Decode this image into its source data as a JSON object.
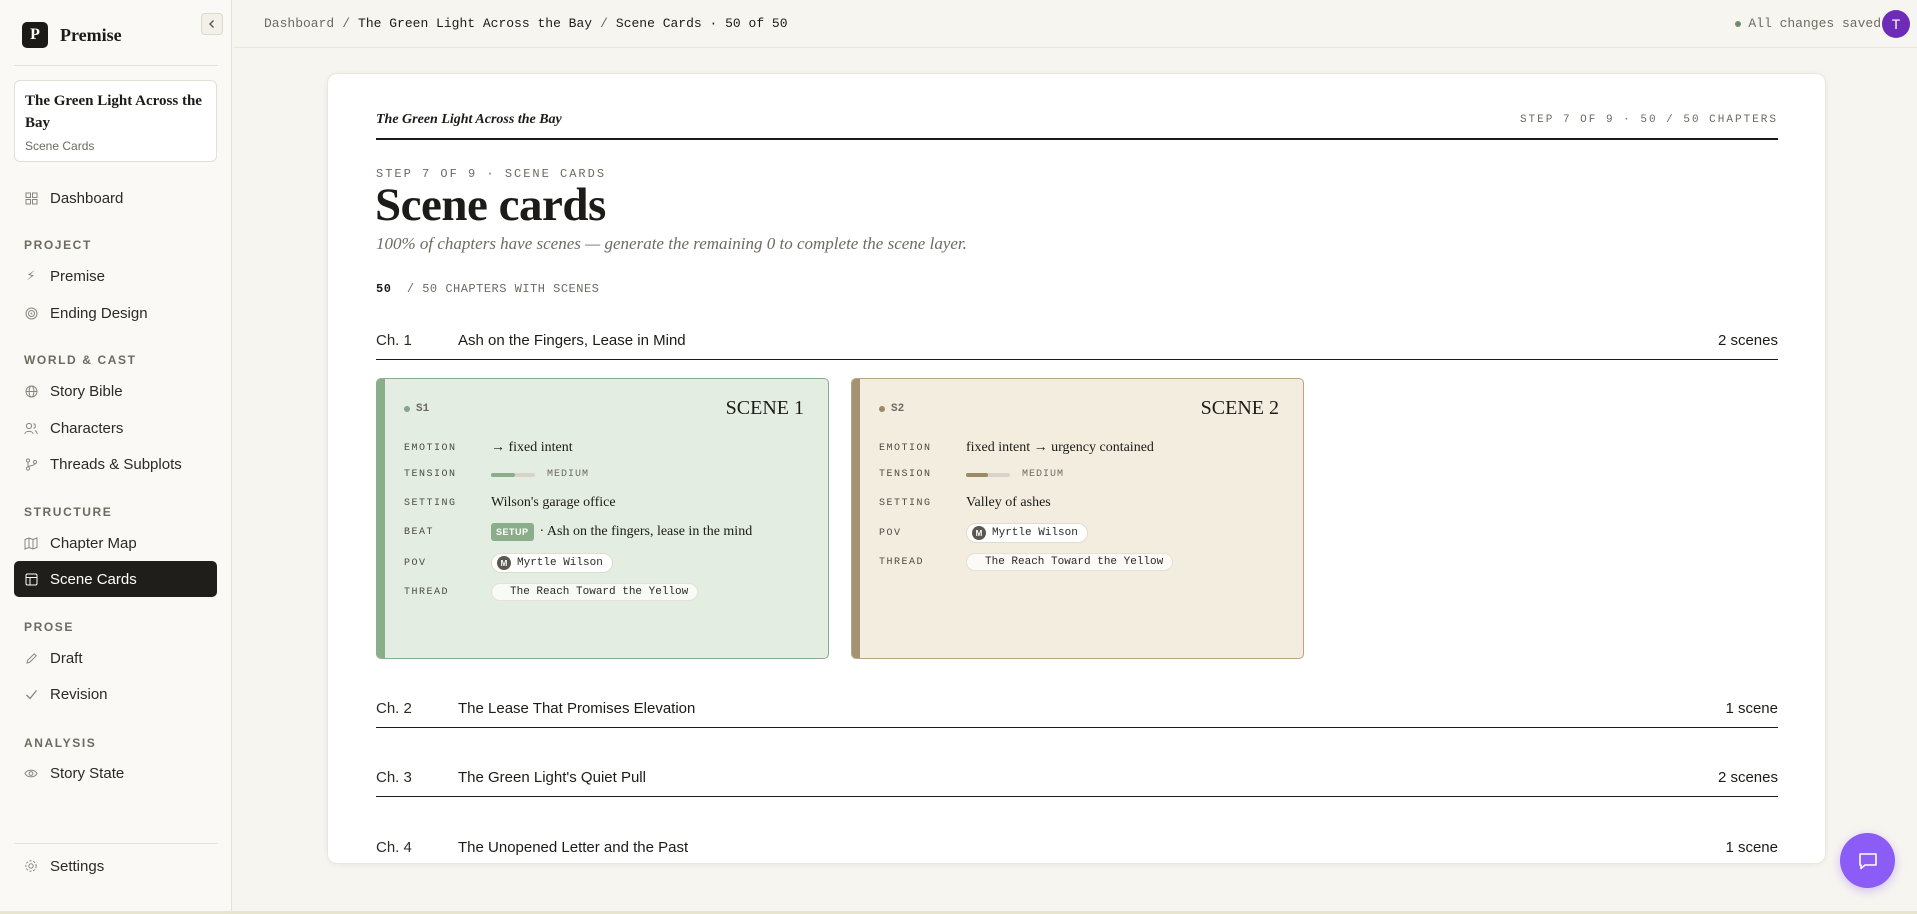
{
  "brand": {
    "logo_letter": "P",
    "name": "Premise",
    "collapse_icon": "chevron-left-icon"
  },
  "project": {
    "title": "The Green Light Across the Bay",
    "subtitle": "Scene Cards"
  },
  "nav": {
    "dashboard": "Dashboard",
    "sections": [
      {
        "label": "PROJECT",
        "items": [
          "Premise",
          "Ending Design"
        ]
      },
      {
        "label": "WORLD & CAST",
        "items": [
          "Story Bible",
          "Characters",
          "Threads & Subplots"
        ]
      },
      {
        "label": "STRUCTURE",
        "items": [
          "Chapter Map",
          "Scene Cards"
        ]
      },
      {
        "label": "PROSE",
        "items": [
          "Draft",
          "Revision"
        ]
      },
      {
        "label": "ANALYSIS",
        "items": [
          "Story State"
        ]
      }
    ],
    "active": "Scene Cards",
    "settings": "Settings"
  },
  "topbar": {
    "breadcrumb": [
      "Dashboard",
      "/",
      "The Green Light Across the Bay",
      "/",
      "Scene Cards · 50 of 50"
    ],
    "save_status": "All changes saved",
    "avatar_letter": "T"
  },
  "page": {
    "head_title": "The Green Light Across the Bay",
    "head_step": "STEP 7 OF 9 · 50 / 50 CHAPTERS",
    "eyebrow": "STEP 7 OF 9 · SCENE CARDS",
    "title": "Scene cards",
    "subtitle": "100% of chapters have scenes — generate the remaining 0 to complete the scene layer.",
    "progress_done": "50",
    "progress_rest": "/ 50 CHAPTERS WITH SCENES"
  },
  "chapters": [
    {
      "num": "Ch. 1",
      "title": "Ash on the Fingers, Lease in Mind",
      "count": "2 scenes"
    },
    {
      "num": "Ch. 2",
      "title": "The Lease That Promises Elevation",
      "count": "1 scene"
    },
    {
      "num": "Ch. 3",
      "title": "The Green Light's Quiet Pull",
      "count": "2 scenes"
    },
    {
      "num": "Ch. 4",
      "title": "The Unopened Letter and the Past",
      "count": "1 scene"
    }
  ],
  "scene_labels": {
    "emotion": "EMOTION",
    "tension": "TENSION",
    "setting": "SETTING",
    "beat": "BEAT",
    "pov": "POV",
    "thread": "THREAD"
  },
  "scenes": [
    {
      "id": "S1",
      "title": "SCENE 1",
      "emotion": "→ fixed intent",
      "tension_level": 0.55,
      "tension_label": "MEDIUM",
      "setting": "Wilson's garage office",
      "beat_tag": "SETUP",
      "beat_text": "· Ash on the fingers, lease in the mind",
      "pov_initial": "M",
      "pov": "Myrtle Wilson",
      "thread": "The Reach Toward the Yellow"
    },
    {
      "id": "S2",
      "title": "SCENE 2",
      "emotion": "fixed intent → urgency contained",
      "tension_level": 0.5,
      "tension_label": "MEDIUM",
      "setting": "Valley of ashes",
      "pov_initial": "M",
      "pov": "Myrtle Wilson",
      "thread": "The Reach Toward the Yellow"
    }
  ],
  "colors": {
    "accent_green": "#8aae89",
    "accent_tan": "#a49270",
    "fab": "#8b5cf6",
    "avatar": "#6d2bb7"
  }
}
